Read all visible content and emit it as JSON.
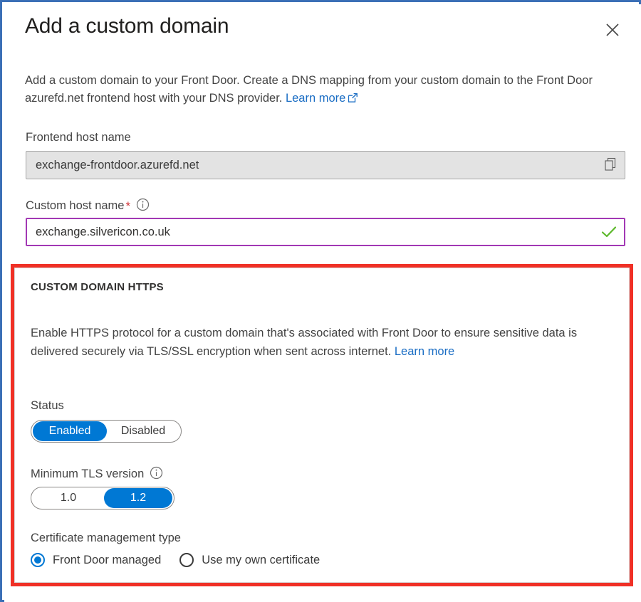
{
  "dialog": {
    "title": "Add a custom domain",
    "close_icon": "close-icon",
    "intro_text": "Add a custom domain to your Front Door. Create a DNS mapping from your custom domain to the Front Door azurefd.net frontend host with your DNS provider.",
    "intro_link": "Learn more",
    "intro_link_icon": "external-link-icon"
  },
  "fields": {
    "frontend_host": {
      "label": "Frontend host name",
      "value": "exchange-frontdoor.azurefd.net",
      "copy_icon": "copy-icon"
    },
    "custom_host": {
      "label": "Custom host name",
      "required_marker": "*",
      "info_icon": "info-icon",
      "value": "exchange.silvericon.co.uk",
      "valid_icon": "checkmark-icon"
    }
  },
  "https_section": {
    "header": "CUSTOM DOMAIN HTTPS",
    "description": "Enable HTTPS protocol for a custom domain that's associated with Front Door to ensure sensitive data is delivered securely via TLS/SSL encryption when sent across internet.",
    "description_link": "Learn more",
    "status": {
      "label": "Status",
      "options": [
        "Enabled",
        "Disabled"
      ],
      "selected": "Enabled"
    },
    "min_tls": {
      "label": "Minimum TLS version",
      "info_icon": "info-icon",
      "options": [
        "1.0",
        "1.2"
      ],
      "selected": "1.2"
    },
    "cert_management": {
      "label": "Certificate management type",
      "options": [
        {
          "label": "Front Door managed",
          "selected": true
        },
        {
          "label": "Use my own certificate",
          "selected": false
        }
      ]
    }
  },
  "colors": {
    "accent": "#0078d4",
    "link": "#1a6dc4",
    "highlight": "#f03026",
    "valid_border": "#a238b4",
    "valid_check": "#5cb82b",
    "required": "#d13438",
    "frame": "#3b6fb6"
  }
}
